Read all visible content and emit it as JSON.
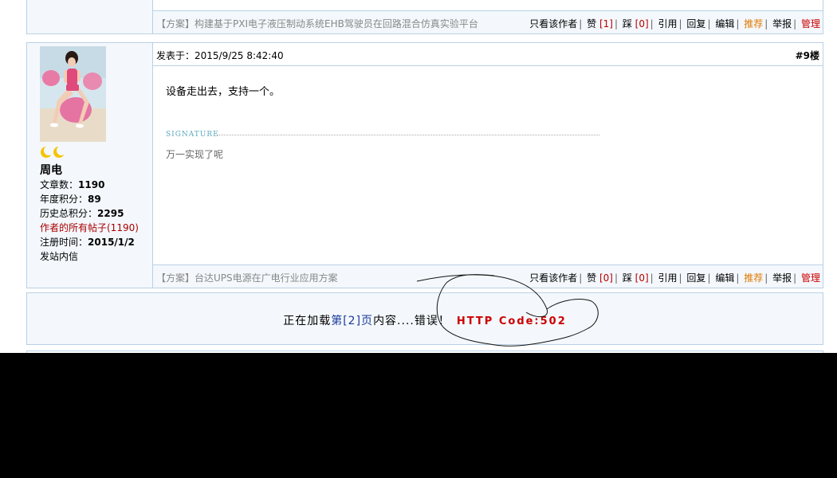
{
  "prev_post": {
    "category": "【方案】",
    "title": "构建基于PXI电子液压制动系统EHB驾驶员在回路混合仿真实验平台",
    "actions": {
      "only_author": "只看该作者",
      "like": "赞",
      "like_count": "[1]",
      "dislike": "踩",
      "dislike_count": "[0]",
      "quote": "引用",
      "reply": "回复",
      "edit": "编辑",
      "recommend": "推荐",
      "report": "举报",
      "manage": "管理"
    }
  },
  "post": {
    "author": {
      "name": "周电",
      "level_icon": "moon-level-icon",
      "posts_label": "文章数：",
      "posts_value": "1190",
      "year_points_label": "年度积分：",
      "year_points_value": "89",
      "total_points_label": "历史总积分：",
      "total_points_value": "2295",
      "all_posts_link": "作者的所有帖子(1190)",
      "register_label": "注册时间：",
      "register_value": "2015/1/2",
      "message_link": "发站内信"
    },
    "posted_at": "发表于：2015/9/25 8:42:40",
    "floor": "#9楼",
    "content": "设备走出去，支持一个。",
    "signature_label": "SIGNATURE",
    "signature": "万一实现了呢",
    "category": "【方案】",
    "title": "台达UPS电源在广电行业应用方案",
    "actions": {
      "only_author": "只看该作者",
      "like": "赞",
      "like_count": "[0]",
      "dislike": "踩",
      "dislike_count": "[0]",
      "quote": "引用",
      "reply": "回复",
      "edit": "编辑",
      "recommend": "推荐",
      "report": "举报",
      "manage": "管理"
    }
  },
  "loading": {
    "prefix": "正在加载",
    "page": "第[2]页",
    "suffix": "内容....错误！",
    "error_code": "HTTP Code:502"
  }
}
